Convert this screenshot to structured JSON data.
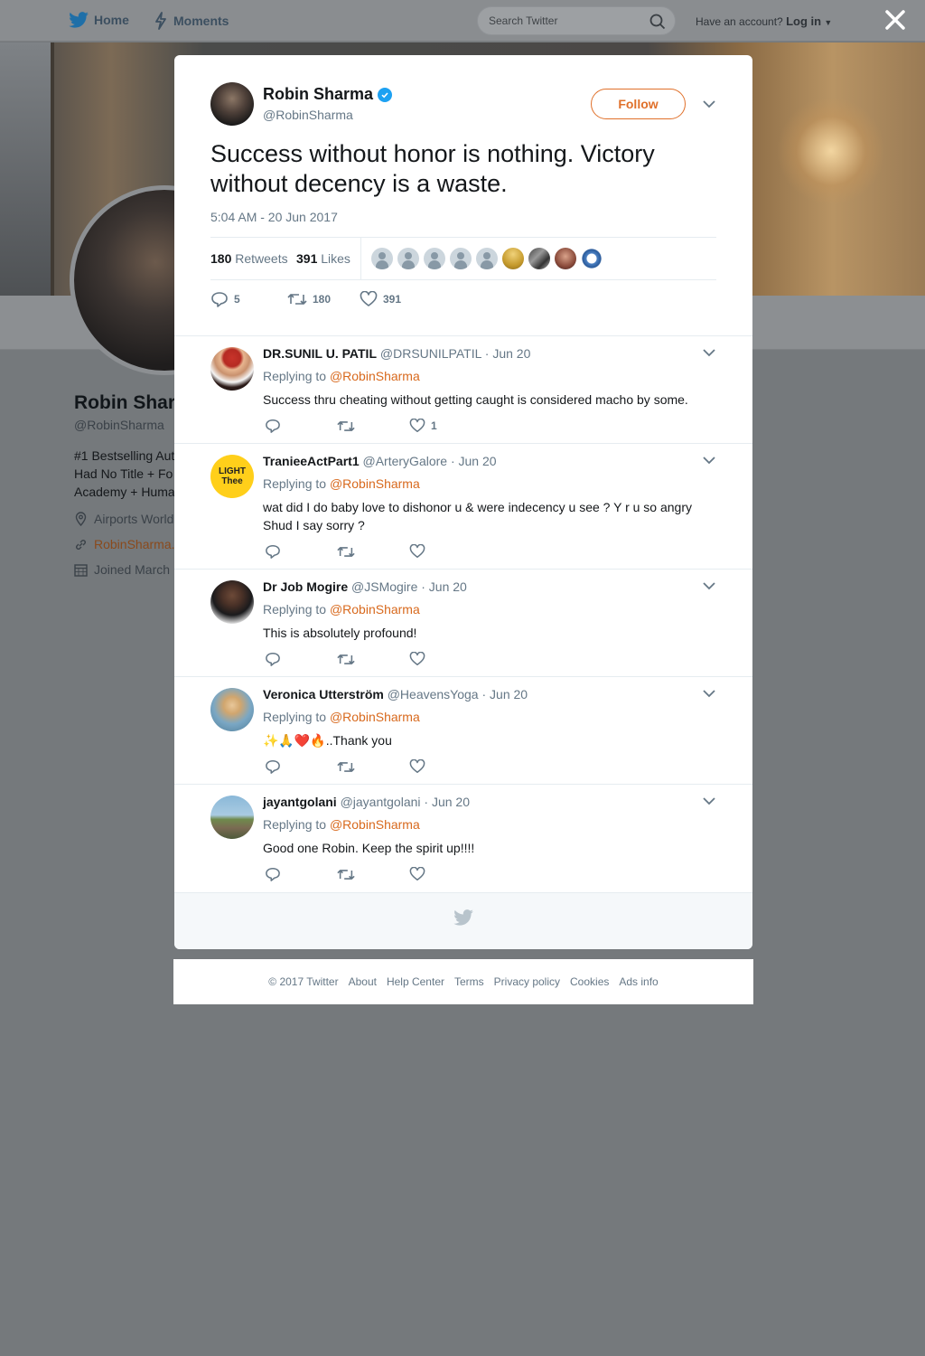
{
  "topnav": {
    "home_label": "Home",
    "moments_label": "Moments",
    "search_placeholder": "Search Twitter",
    "account_prompt": "Have an account?",
    "login_label": "Log in"
  },
  "profile": {
    "name": "Robin Shar",
    "handle": "@RobinSharma",
    "bio": "#1 Bestselling Aut\nHad No Title + Fo\nAcademy + Huma",
    "location": "Airports World",
    "url": "RobinSharma.",
    "joined": "Joined March"
  },
  "tweet": {
    "author_name": "Robin Sharma",
    "author_handle": "@RobinSharma",
    "follow_label": "Follow",
    "text": "Success without honor is nothing. Victory without decency is a waste.",
    "timestamp": "5:04 AM - 20 Jun 2017",
    "retweets_count": "180",
    "retweets_label": "Retweets",
    "likes_count": "391",
    "likes_label": "Likes",
    "reply_count": "5",
    "retweet_action_count": "180",
    "like_action_count": "391"
  },
  "replies": [
    {
      "name": "DR.SUNIL U. PATIL",
      "handle": "@DRSUNILPATIL",
      "date": "· Jun 20",
      "replying_prefix": "Replying to",
      "replying_to": "@RobinSharma",
      "text": "Success thru cheating without getting caught is considered macho by some.",
      "like_count": "1"
    },
    {
      "name": "TranieeActPart1",
      "handle": "@ArteryGalore",
      "date": "· Jun 20",
      "replying_prefix": "Replying to",
      "replying_to": "@RobinSharma",
      "text": "wat did I do baby love to dishonor u & were indecency u see ? Y r u so angry Shud I say sorry ?",
      "avatar_text_line1": "LIGHT",
      "avatar_text_line2": "Thee"
    },
    {
      "name": "Dr Job Mogire",
      "handle": "@JSMogire",
      "date": "· Jun 20",
      "replying_prefix": "Replying to",
      "replying_to": "@RobinSharma",
      "text": "This is absolutely profound!"
    },
    {
      "name": "Veronica Utterström",
      "handle": "@HeavensYoga",
      "date": "· Jun 20",
      "replying_prefix": "Replying to",
      "replying_to": "@RobinSharma",
      "text": "✨🙏❤️🔥..Thank you"
    },
    {
      "name": "jayantgolani",
      "handle": "@jayantgolani",
      "date": "· Jun 20",
      "replying_prefix": "Replying to",
      "replying_to": "@RobinSharma",
      "text": "Good one Robin. Keep the spirit up!!!!"
    }
  ],
  "footer": {
    "copyright": "© 2017 Twitter",
    "about": "About",
    "help": "Help Center",
    "terms": "Terms",
    "privacy": "Privacy policy",
    "cookies": "Cookies",
    "ads": "Ads info"
  },
  "colors": {
    "accent": "#e0702a",
    "link": "#d8691d",
    "verified": "#1da1f2",
    "overlay": "#75797c"
  }
}
